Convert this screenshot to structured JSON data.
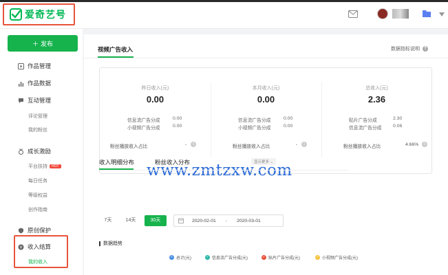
{
  "header": {
    "logo_text": "爱奇艺号"
  },
  "sidebar": {
    "publish_label": "发布",
    "groups": [
      {
        "label": "作品管理"
      },
      {
        "label": "作品数据"
      },
      {
        "label": "互动管理",
        "subs": [
          "评论管理",
          "我的粉丝"
        ]
      },
      {
        "label": "成长激励",
        "subs": [
          "平台扶持",
          "每日任务",
          "等级权益",
          "创作指南"
        ],
        "hot_badge": "HOT"
      },
      {
        "label": "原创保护"
      },
      {
        "label": "收入结算",
        "subs": [
          "我的收入"
        ]
      }
    ]
  },
  "main": {
    "tab_title": "视频广告收入",
    "help_link": "数据指标说明",
    "columns": [
      {
        "title": "昨日收入(元)",
        "value": "0.00",
        "rows": [
          {
            "label": "信息流广告分成",
            "value": "0.00"
          },
          {
            "label": "小视频广告分成",
            "value": "0.00"
          }
        ],
        "fans_label": "粉丝播放收入占比",
        "fans_value": "-"
      },
      {
        "title": "本月收入(元)",
        "value": "0.00",
        "rows": [
          {
            "label": "信息流广告分成",
            "value": "0.00"
          },
          {
            "label": "小视频广告分成",
            "value": "0.00"
          }
        ],
        "fans_label": "粉丝播放收入占比",
        "fans_value": "-"
      },
      {
        "title": "总收入(元)",
        "value": "2.36",
        "rows": [
          {
            "label": "贴片广告分成",
            "value": "2.30"
          },
          {
            "label": "信息流广告分成",
            "value": "0.06"
          }
        ],
        "fans_label": "粉丝播放收入占比",
        "fans_value": "4.66%"
      }
    ],
    "show_more": "显示更多",
    "watermark": "www.zmtzxw.com",
    "subtabs": [
      "收入明细分布",
      "粉丝收入分布"
    ],
    "ranges": [
      "7天",
      "14天",
      "30天"
    ],
    "date_start": "2020-02-01",
    "date_sep": "-",
    "date_end": "2020-03-01",
    "trend_title": "数据趋势",
    "legend": [
      {
        "label": "总计(元)",
        "color": "#4a90e2"
      },
      {
        "label": "信息流广告分成(元)",
        "color": "#2ab7a9"
      },
      {
        "label": "贴片广告分成(元)",
        "color": "#e8533b"
      },
      {
        "label": "小视频广告分成(元)",
        "color": "#f5c342"
      }
    ]
  },
  "colors": {
    "brand": "#16b34d",
    "highlight_box": "#e8533b",
    "watermark": "#2b6ad6"
  }
}
